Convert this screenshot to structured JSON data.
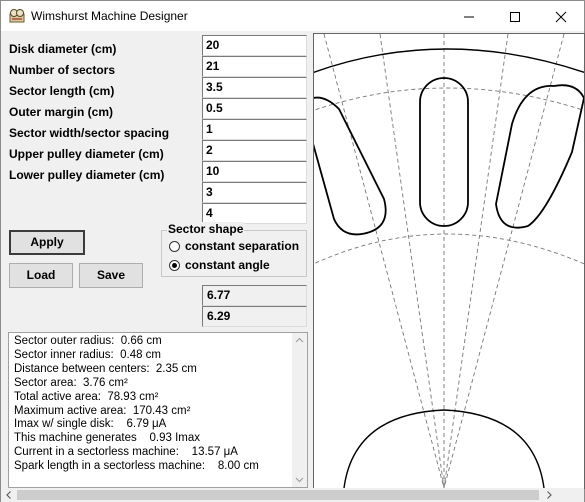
{
  "window": {
    "title": "Wimshurst Machine Designer"
  },
  "fields": [
    {
      "label": "Disk diameter (cm)",
      "value": "20"
    },
    {
      "label": "Number of sectors",
      "value": "21"
    },
    {
      "label": "Sector length (cm)",
      "value": "3.5"
    },
    {
      "label": "Outer margin (cm)",
      "value": "0.5"
    },
    {
      "label": "Sector width/sector spacing",
      "value": "1"
    },
    {
      "label": "Upper pulley diameter (cm)",
      "value": "2"
    },
    {
      "label": "Lower pulley diameter (cm)",
      "value": "10"
    }
  ],
  "extra_fields": [
    "3",
    "4"
  ],
  "buttons": {
    "apply": "Apply",
    "load": "Load",
    "save": "Save"
  },
  "sector_shape": {
    "title": "Sector shape",
    "options": [
      "constant separation",
      "constant angle"
    ],
    "selected": "constant angle"
  },
  "results": [
    "6.77",
    "6.29"
  ],
  "output_lines": [
    "Sector outer radius:  0.66 cm",
    "Sector inner radius:  0.48 cm",
    "Distance between centers:  2.35 cm",
    "Sector area:  3.76 cm²",
    "Total active area:  78.93 cm²",
    "Maximum active area:  170.43 cm²",
    "Imax w/ single disk:    6.79 μA",
    "This machine generates    0.93 Imax",
    "Current in a sectorless machine:    13.57 μA",
    "Spark length in a sectorless machine:    8.00 cm"
  ],
  "icons": {
    "app": "machine-icon",
    "minimize": "minimize-icon",
    "maximize": "maximize-icon",
    "close": "close-icon"
  }
}
